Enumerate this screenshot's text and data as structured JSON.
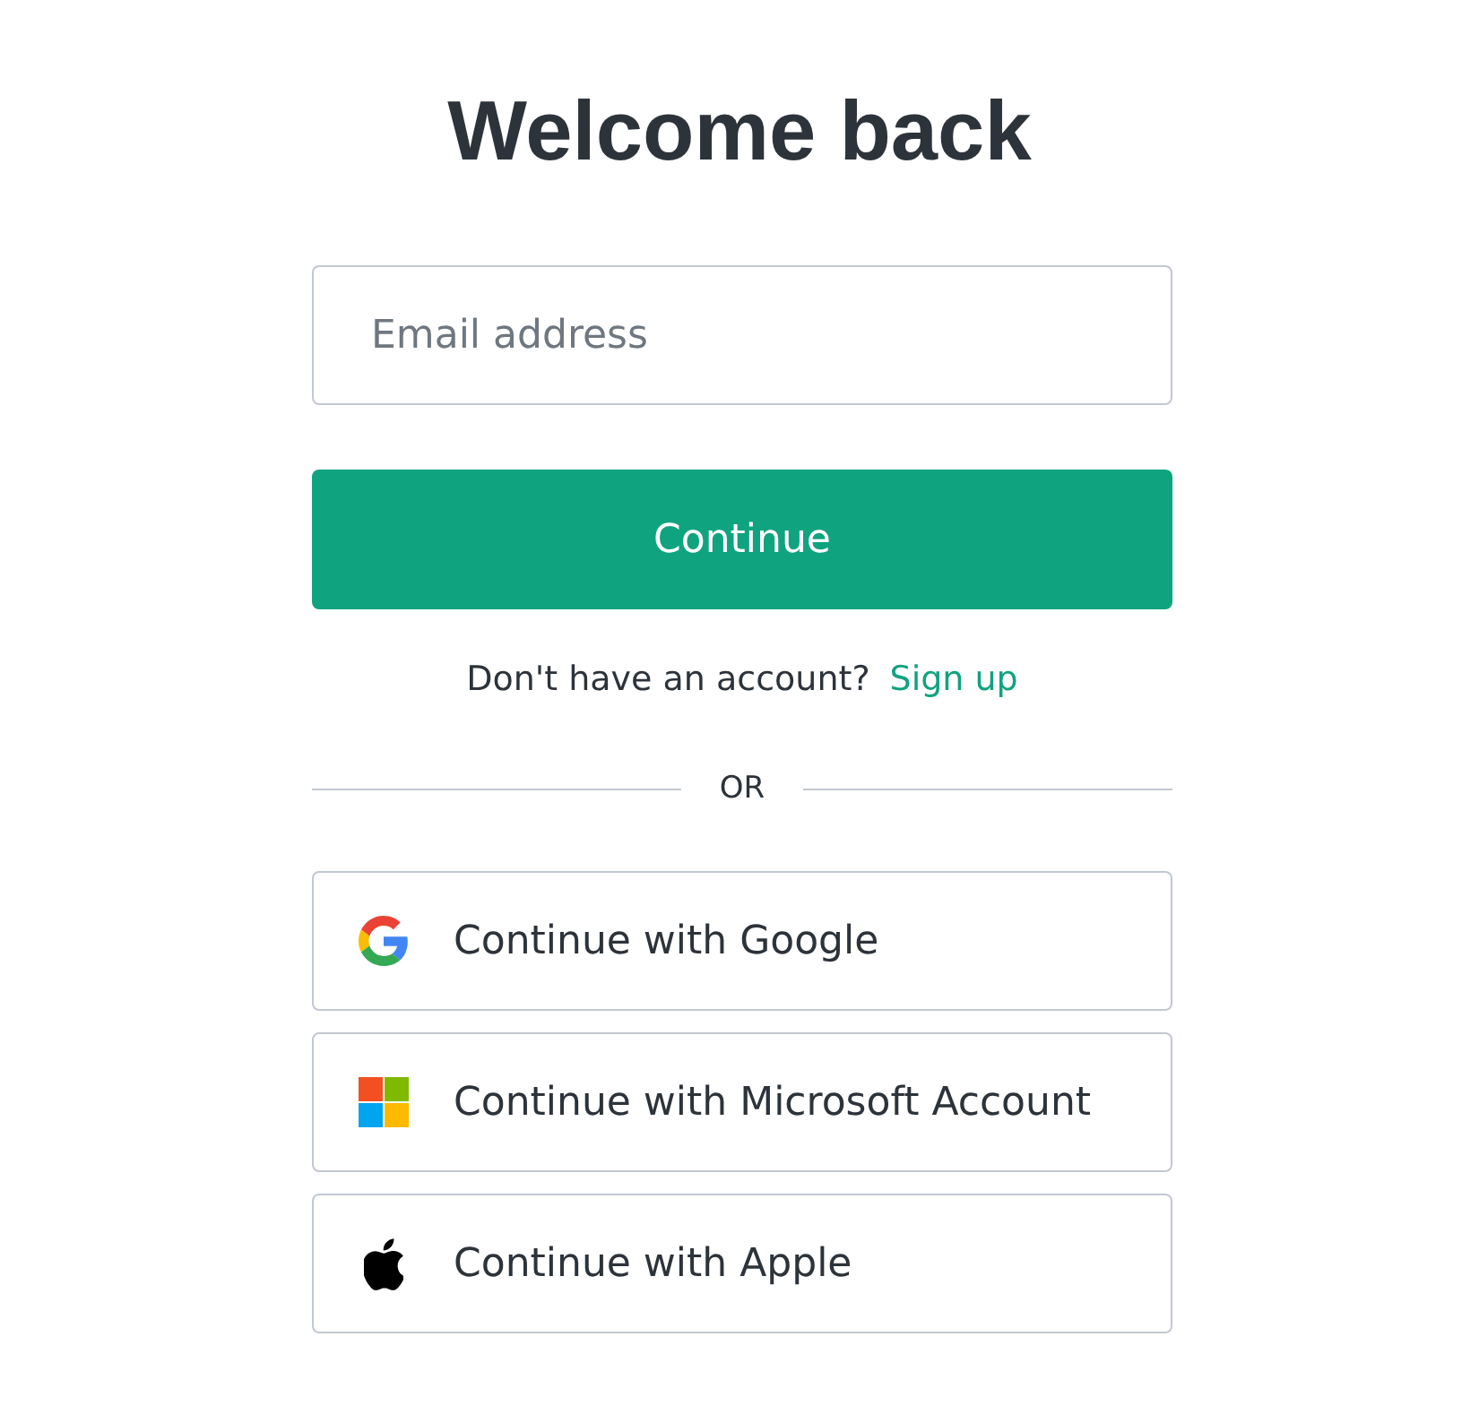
{
  "heading": "Welcome back",
  "email_field": {
    "placeholder": "Email address"
  },
  "continue_button": "Continue",
  "signup_prompt": {
    "text": "Don't have an account?",
    "link": "Sign up"
  },
  "divider": "OR",
  "social_buttons": [
    {
      "kind": "google",
      "label": "Continue with Google"
    },
    {
      "kind": "microsoft",
      "label": "Continue with Microsoft Account"
    },
    {
      "kind": "apple",
      "label": "Continue with Apple"
    }
  ]
}
